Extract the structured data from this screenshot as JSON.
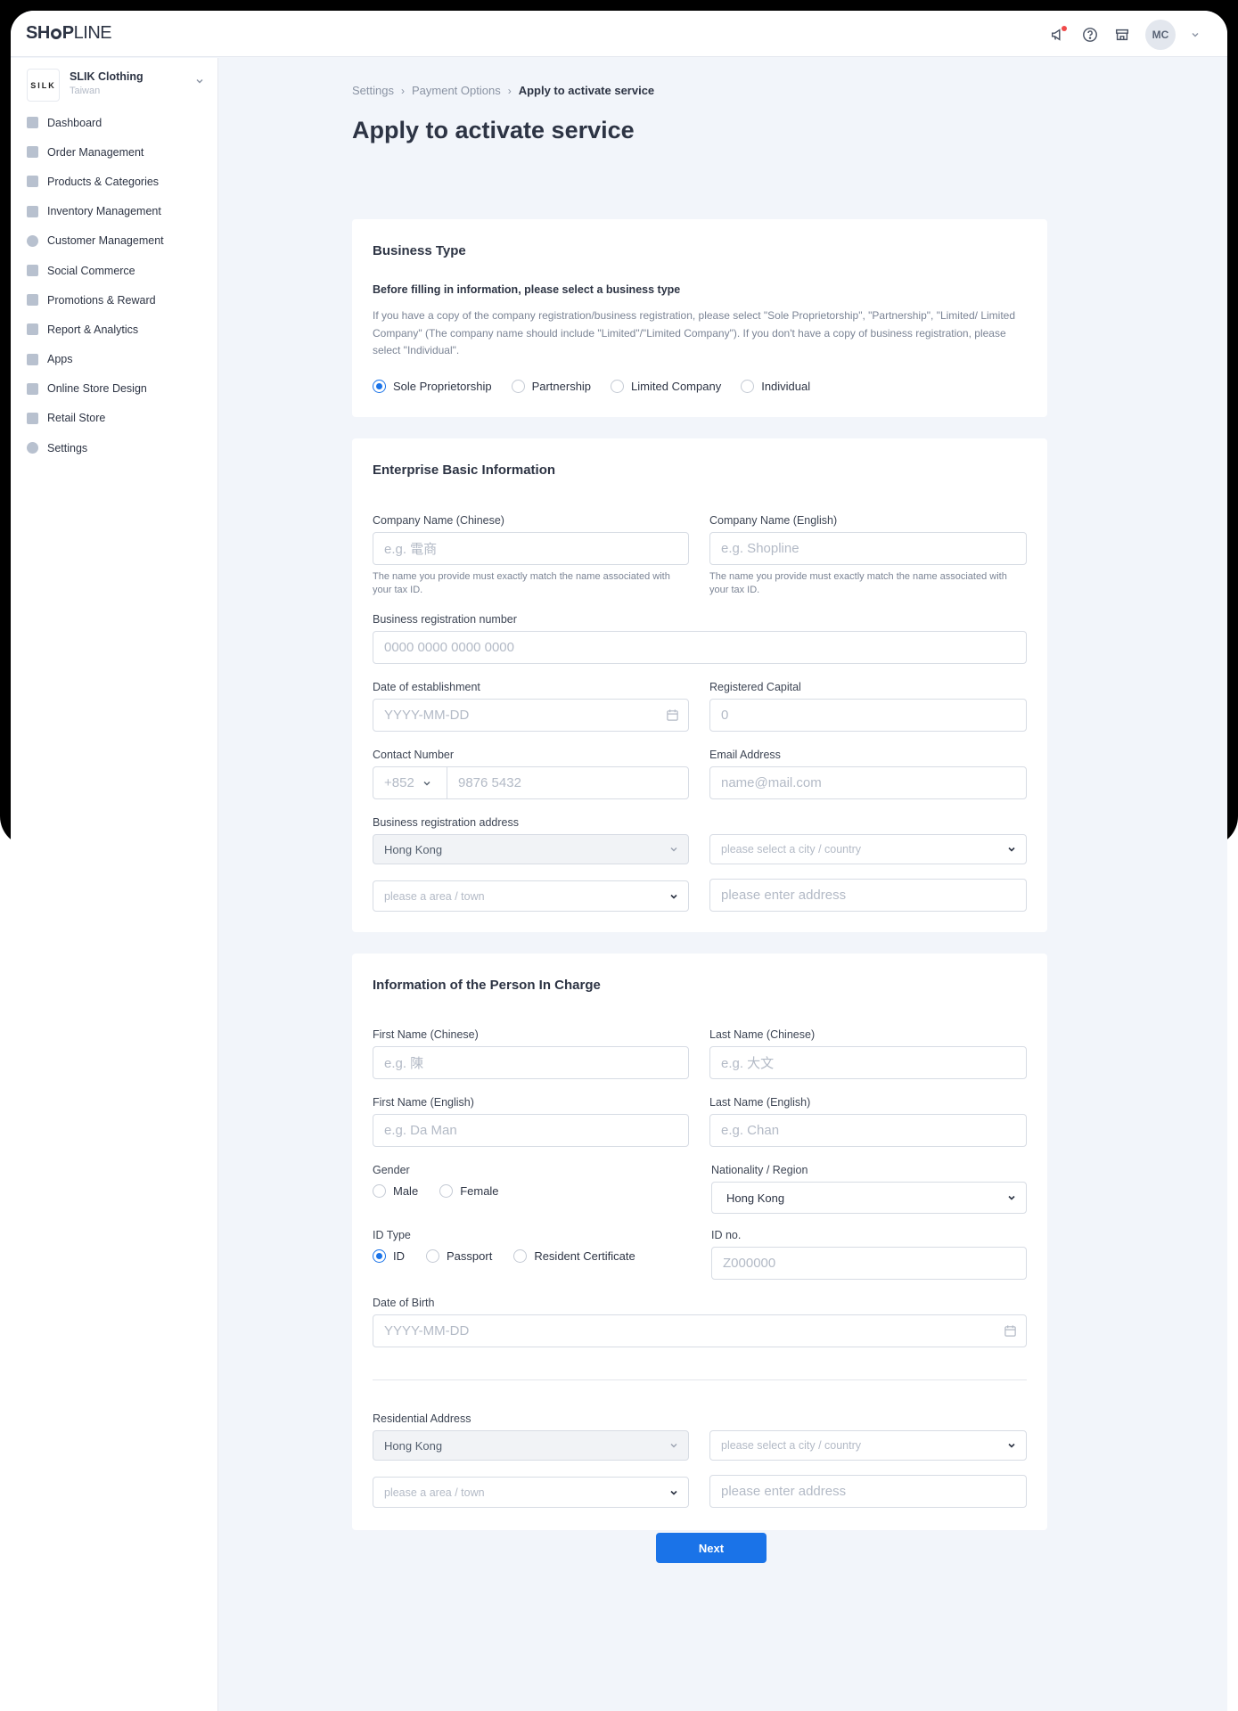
{
  "brand": {
    "logo_bold_1": "SH",
    "logo_bold_2": "P",
    "logo_light": "LINE"
  },
  "topbar": {
    "avatar_initials": "MC"
  },
  "store": {
    "logo_text": "SILK",
    "name": "SLIK Clothing",
    "region": "Taiwan"
  },
  "sidebar": {
    "items": [
      {
        "label": "Dashboard",
        "icon": "dashboard-icon"
      },
      {
        "label": "Order Management",
        "icon": "order-icon"
      },
      {
        "label": "Products & Categories",
        "icon": "products-icon"
      },
      {
        "label": "Inventory Management",
        "icon": "inventory-icon"
      },
      {
        "label": "Customer Management",
        "icon": "customer-icon"
      },
      {
        "label": "Social Commerce",
        "icon": "social-icon"
      },
      {
        "label": "Promotions & Reward",
        "icon": "promotion-icon"
      },
      {
        "label": "Report & Analytics",
        "icon": "report-icon"
      },
      {
        "label": "Apps",
        "icon": "apps-icon"
      },
      {
        "label": "Online Store Design",
        "icon": "design-icon"
      },
      {
        "label": "Retail Store",
        "icon": "retail-icon"
      },
      {
        "label": "Settings",
        "icon": "settings-icon"
      }
    ]
  },
  "breadcrumb": {
    "items": [
      "Settings",
      "Payment Options",
      "Apply to activate service"
    ]
  },
  "page": {
    "title": "Apply to activate service"
  },
  "business_type": {
    "title": "Business Type",
    "subtitle": "Before filling in information, please select a business type",
    "description": "If you have a copy of the company registration/business registration, please select \"Sole Proprietorship\", \"Partnership\", \"Limited/ Limited Company\" (The company name should include \"Limited\"/\"Limited Company\"). If you don't have a copy of business registration, please select \"Individual\".",
    "options": [
      "Sole Proprietorship",
      "Partnership",
      "Limited Company",
      "Individual"
    ],
    "selected": "Sole Proprietorship"
  },
  "enterprise": {
    "title": "Enterprise Basic Information",
    "company_cn_label": "Company Name (Chinese)",
    "company_cn_placeholder": "e.g. 電商",
    "company_en_label": "Company Name (English)",
    "company_en_placeholder": "e.g. Shopline",
    "name_hint": "The name you provide must exactly match the name associated with your tax ID.",
    "brn_label": "Business registration number",
    "brn_placeholder": "0000 0000 0000 0000",
    "doe_label": "Date of establishment",
    "doe_placeholder": "YYYY-MM-DD",
    "capital_label": "Registered Capital",
    "capital_placeholder": "0",
    "contact_label": "Contact Number",
    "contact_code": "+852",
    "contact_placeholder": "9876 5432",
    "email_label": "Email Address",
    "email_placeholder": "name@mail.com",
    "address_label": "Business registration address",
    "address_region": "Hong Kong",
    "address_city_placeholder": "please select a city / country",
    "address_area_placeholder": "please a area / town",
    "address_detail_placeholder": "please enter address"
  },
  "person": {
    "title": "Information of the Person In Charge",
    "first_cn_label": "First Name (Chinese)",
    "first_cn_placeholder": "e.g. 陳",
    "last_cn_label": "Last Name (Chinese)",
    "last_cn_placeholder": "e.g. 大文",
    "first_en_label": "First Name (English)",
    "first_en_placeholder": "e.g. Da Man",
    "last_en_label": "Last Name (English)",
    "last_en_placeholder": "e.g. Chan",
    "gender_label": "Gender",
    "gender_options": [
      "Male",
      "Female"
    ],
    "nationality_label": "Nationality / Region",
    "nationality_value": "Hong Kong",
    "id_type_label": "ID Type",
    "id_type_options": [
      "ID",
      "Passport",
      "Resident Certificate"
    ],
    "id_type_selected": "ID",
    "id_no_label": "ID no.",
    "id_no_placeholder": "Z000000",
    "dob_label": "Date of Birth",
    "dob_placeholder": "YYYY-MM-DD",
    "res_address_label": "Residential Address",
    "res_region": "Hong Kong",
    "res_city_placeholder": "please select a city / country",
    "res_area_placeholder": "please a area / town",
    "res_detail_placeholder": "please enter address"
  },
  "actions": {
    "next_label": "Next"
  },
  "colors": {
    "primary": "#1a73e8",
    "background": "#f2f5fa",
    "text": "#2d3444"
  }
}
